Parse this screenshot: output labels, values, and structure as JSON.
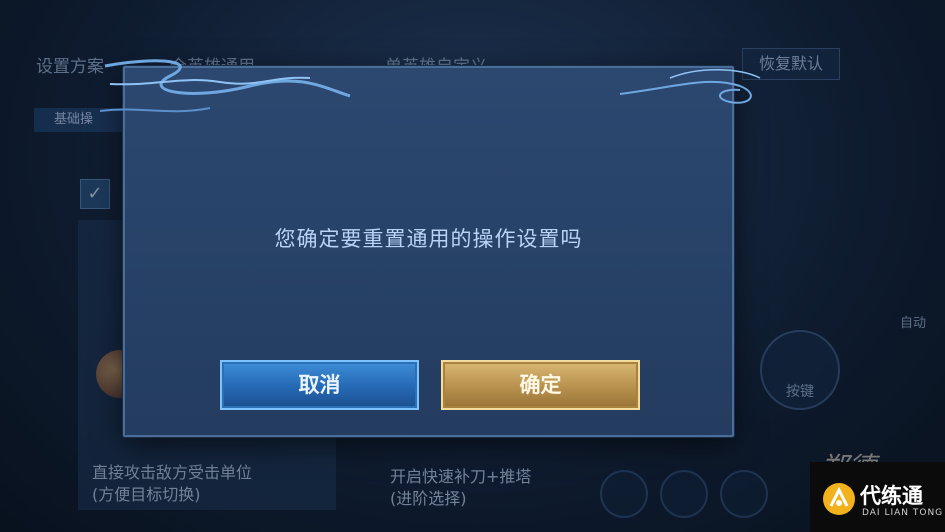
{
  "background": {
    "scheme_label": "设置方案",
    "option_all_heroes": "全英雄通用",
    "option_single_hero": "单英雄自定义",
    "restore_default": "恢复默认",
    "tab_basic": "基础操",
    "check_mark": "✓",
    "left_desc_line1": "直接攻击敌方受击单位",
    "left_desc_line2": "(方便目标切换)",
    "mid_desc_line1": "开启快速补刀+推塔",
    "mid_desc_line2": "(进阶选择)",
    "right_button": "按键",
    "side_text": "自动"
  },
  "dialog": {
    "message": "您确定要重置通用的操作设置吗",
    "cancel_label": "取消",
    "confirm_label": "确定"
  },
  "watermark": {
    "brand": "代练通",
    "sub": "DAI LIAN TONG",
    "script": "郑德"
  },
  "colors": {
    "cancel_button": "#2f7cc6",
    "confirm_button": "#c29b55",
    "dialog_bg": "#2a4569"
  }
}
